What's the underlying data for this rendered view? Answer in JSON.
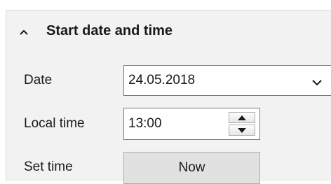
{
  "section": {
    "title": "Start date and time",
    "expanded": true,
    "icon": "chevron-up-icon"
  },
  "date": {
    "label": "Date",
    "value": "24.05.2018",
    "icon": "chevron-down-icon"
  },
  "local_time": {
    "label": "Local time",
    "value": "13:00",
    "up_icon": "triangle-up-icon",
    "down_icon": "triangle-down-icon"
  },
  "set_time": {
    "label": "Set time",
    "button_label": "Now"
  },
  "colors": {
    "panel_background": "#f2f2f2",
    "field_background": "#ffffff",
    "field_border": "#7a7a7a",
    "button_background": "#e1e1e1"
  }
}
